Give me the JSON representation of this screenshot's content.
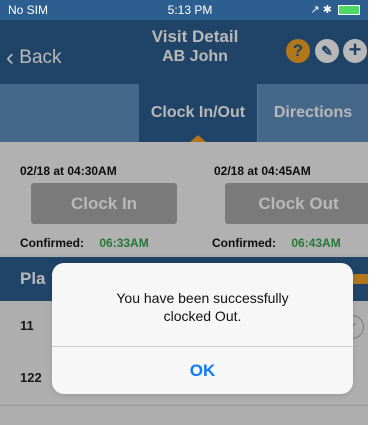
{
  "status": {
    "carrier": "No SIM",
    "time": "5:13 PM",
    "right": "⚡✈ ▮"
  },
  "nav": {
    "back": "Back",
    "title": "Visit Detail",
    "subtitle": "AB John"
  },
  "tabs": [
    "",
    "Clock In/Out",
    "Directions"
  ],
  "clock": {
    "left_datetime": "02/18 at 04:30AM",
    "right_datetime": "02/18 at 04:45AM",
    "clock_in_label": "Clock In",
    "clock_out_label": "Clock Out",
    "confirmed_label": "Confirmed:",
    "left_confirmed_time": "06:33AM",
    "right_confirmed_time": "06:43AM"
  },
  "places": {
    "label": "Pla",
    "rows": [
      {
        "num": "11",
        "text": ""
      },
      {
        "num": "122",
        "text": ""
      }
    ]
  },
  "alert": {
    "message_line1": "You have been successfully",
    "message_line2": "clocked Out.",
    "ok_label": "OK"
  },
  "colors": {
    "header_bg": "#2c5f90",
    "tab_bg": "#5f8fc0",
    "accent": "#f5a623",
    "confirm_green": "#36a64f",
    "link_blue": "#0a7aff"
  }
}
